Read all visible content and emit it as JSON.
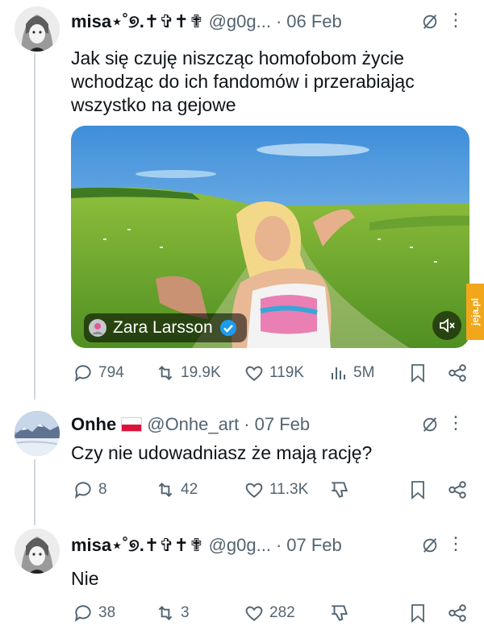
{
  "tweets": [
    {
      "name": "misa⋆˚୭.✝︎✞✝︎✟",
      "handle": "@g0g...",
      "date": "06 Feb",
      "text": "Jak się czuję niszcząc homofobom życie wchodząc do ich fandomów i przerabiając wszystko na gejowe",
      "media": {
        "caption": "Zara Larsson",
        "verified": true
      },
      "stats": {
        "replies": "794",
        "reposts": "19.9K",
        "likes": "119K",
        "views": "5M"
      }
    },
    {
      "name": "Onhe",
      "handle": "@Onhe_art",
      "date": "07 Feb",
      "text": "Czy nie udowadniasz że mają rację?",
      "stats": {
        "replies": "8",
        "reposts": "42",
        "likes": "11.3K"
      }
    },
    {
      "name": "misa⋆˚୭.✝︎✞✝︎✟",
      "handle": "@g0g...",
      "date": "07 Feb",
      "text": "Nie",
      "stats": {
        "replies": "38",
        "reposts": "3",
        "likes": "282"
      }
    }
  ],
  "watermark": "jeja.pl",
  "colors": {
    "muted": "#536471",
    "text": "#0f1419",
    "verified": "#1d9bf0",
    "line": "#cfd9de"
  },
  "icons": [
    "reply-icon",
    "repost-icon",
    "like-icon",
    "views-icon",
    "bookmark-icon",
    "share-icon",
    "grok-icon",
    "more-icon",
    "dislike-icon",
    "mute-icon",
    "verified-icon"
  ]
}
